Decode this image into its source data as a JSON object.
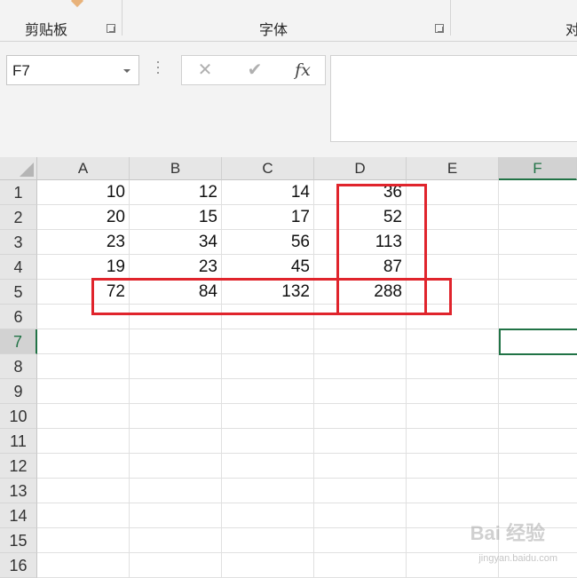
{
  "ribbon": {
    "groups": [
      {
        "label": "剪贴板"
      },
      {
        "label": "字体"
      },
      {
        "label": "对"
      }
    ]
  },
  "formula_bar": {
    "name_box": "F7",
    "cancel_icon": "✕",
    "enter_icon": "✔",
    "fx_label": "fx",
    "formula": ""
  },
  "sheet": {
    "columns": [
      "A",
      "B",
      "C",
      "D",
      "E",
      "F"
    ],
    "rows": [
      "1",
      "2",
      "3",
      "4",
      "5",
      "6",
      "7",
      "8",
      "9",
      "10",
      "11",
      "12",
      "13",
      "14",
      "15",
      "16"
    ],
    "active_cell": "F7",
    "cells": [
      [
        "10",
        "12",
        "14",
        "36"
      ],
      [
        "20",
        "15",
        "17",
        "52"
      ],
      [
        "23",
        "34",
        "56",
        "113"
      ],
      [
        "19",
        "23",
        "45",
        "87"
      ],
      [
        "72",
        "84",
        "132",
        "288"
      ]
    ]
  },
  "watermark": {
    "text": "Bai 经验",
    "sub": "jingyan.baidu.com"
  },
  "colors": {
    "accent": "#217346",
    "highlight": "#e0242c"
  }
}
